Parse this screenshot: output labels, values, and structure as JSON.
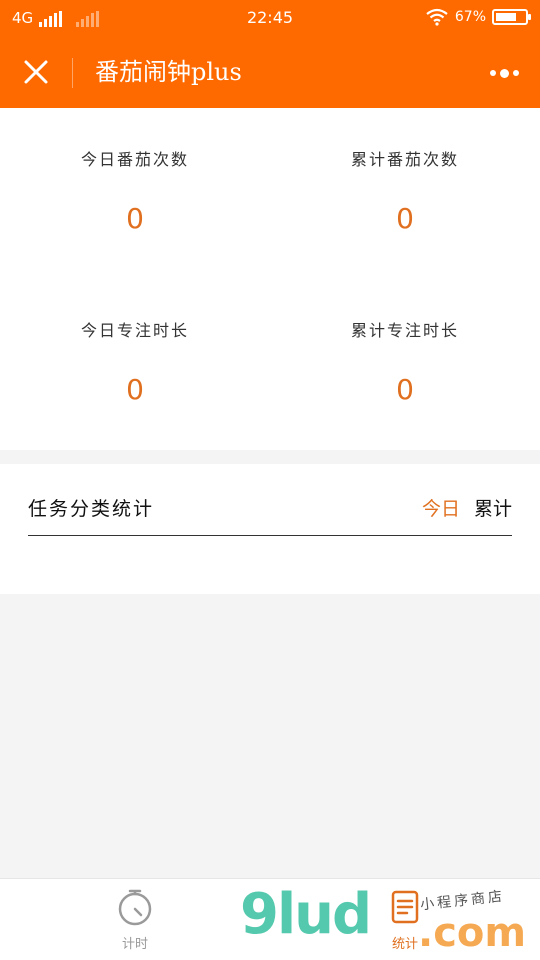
{
  "status_bar": {
    "network": "4G",
    "time": "22:45",
    "battery": "67%"
  },
  "header": {
    "title": "番茄闹钟plus"
  },
  "stats": {
    "today_count_label": "今日番茄次数",
    "today_count_value": "0",
    "total_count_label": "累计番茄次数",
    "total_count_value": "0",
    "today_focus_label": "今日专注时长",
    "today_focus_value": "0",
    "total_focus_label": "累计专注时长",
    "total_focus_value": "0"
  },
  "category": {
    "title": "任务分类统计",
    "tab_today": "今日",
    "tab_total": "累计"
  },
  "tabbar": {
    "timer_label": "计时",
    "stats_label": "统计"
  },
  "watermark": {
    "brand": "9lud",
    "domain": ".com",
    "tagline": "小程序商店"
  },
  "colors": {
    "brand": "#ff6a00",
    "accent": "#e07020"
  }
}
